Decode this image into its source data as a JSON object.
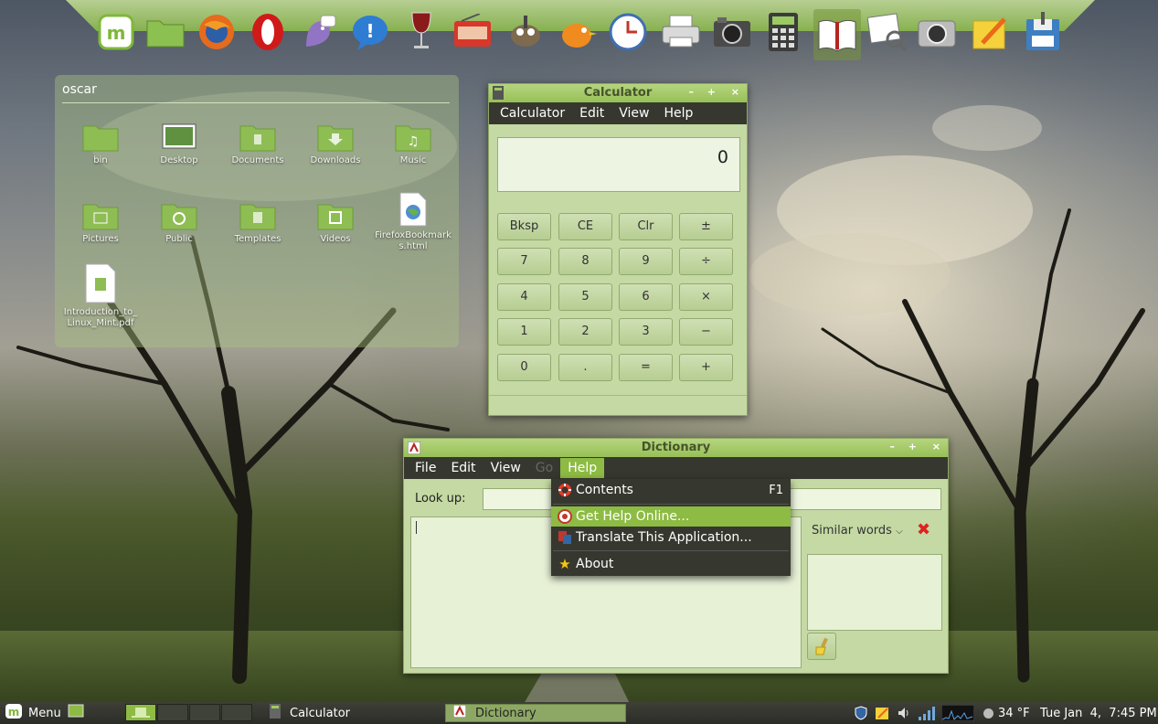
{
  "dock": {
    "items": [
      "linux-mint-menu",
      "files",
      "firefox",
      "opera",
      "pidgin",
      "notifications",
      "wine",
      "radio",
      "gimp",
      "thunderbird-bird",
      "calendar",
      "printer",
      "camera",
      "calculator",
      "dictionary",
      "image-viewer",
      "screenshot",
      "text-editor",
      "save"
    ]
  },
  "desklet": {
    "title": "oscar",
    "files": [
      {
        "label": "bin",
        "icon": "folder-icon"
      },
      {
        "label": "Desktop",
        "icon": "folder-desktop-icon"
      },
      {
        "label": "Documents",
        "icon": "folder-documents-icon"
      },
      {
        "label": "Downloads",
        "icon": "folder-downloads-icon"
      },
      {
        "label": "Music",
        "icon": "folder-music-icon"
      },
      {
        "label": "Pictures",
        "icon": "folder-pictures-icon"
      },
      {
        "label": "Public",
        "icon": "folder-public-icon"
      },
      {
        "label": "Templates",
        "icon": "folder-templates-icon"
      },
      {
        "label": "Videos",
        "icon": "folder-videos-icon"
      },
      {
        "label": "FirefoxBookmarks.html",
        "icon": "html-file-icon"
      },
      {
        "label": "Introduction_to_Linux_Mint.pdf",
        "icon": "pdf-file-icon"
      }
    ]
  },
  "calculator": {
    "title": "Calculator",
    "menu": [
      "Calculator",
      "Edit",
      "View",
      "Help"
    ],
    "display": "0",
    "buttons": [
      [
        "Bksp",
        "CE",
        "Clr",
        "±"
      ],
      [
        "7",
        "8",
        "9",
        "÷"
      ],
      [
        "4",
        "5",
        "6",
        "×"
      ],
      [
        "1",
        "2",
        "3",
        "−"
      ],
      [
        "0",
        ".",
        "=",
        "+"
      ]
    ]
  },
  "dictionary": {
    "title": "Dictionary",
    "menu": [
      "File",
      "Edit",
      "View",
      "Go",
      "Help"
    ],
    "lookup_label": "Look up:",
    "lookup_value": "",
    "similar_label": "Similar words",
    "help_menu": {
      "items": [
        {
          "label": "Contents",
          "accel": "F1",
          "icon": "lifebuoy-icon"
        },
        {
          "label": "Get Help Online...",
          "accel": "",
          "icon": "help-online-icon",
          "highlighted": true
        },
        {
          "label": "Translate This Application...",
          "accel": "",
          "icon": "translate-icon"
        },
        {
          "label": "About",
          "accel": "",
          "icon": "star-icon"
        }
      ]
    }
  },
  "panel": {
    "menu_label": "Menu",
    "tasks": [
      {
        "label": "Calculator",
        "active": false
      },
      {
        "label": "Dictionary",
        "active": true
      }
    ],
    "weather": "34 °F",
    "clock": "Tue Jan  4,  7:45 PM"
  },
  "colors": {
    "accent": "#8dbb43",
    "menu_bg": "#36382f",
    "window_bg": "#c4d9a3"
  }
}
